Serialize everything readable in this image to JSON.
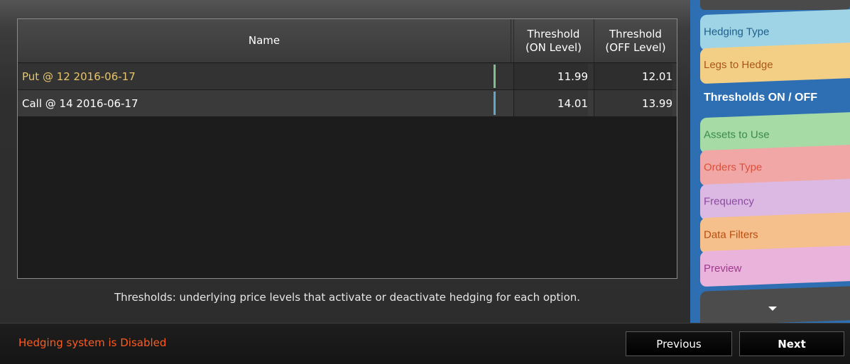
{
  "table": {
    "headers": {
      "name": "Name",
      "on_line1": "Threshold",
      "on_line2": "(ON Level)",
      "off_line1": "Threshold",
      "off_line2": "(OFF Level)"
    },
    "rows": [
      {
        "name": "Put @ 12 2016-06-17",
        "on": "11.99",
        "off": "12.01",
        "name_color": "#e8c56a",
        "marker_color": "#7fc08a"
      },
      {
        "name": "Call @ 14 2016-06-17",
        "on": "14.01",
        "off": "13.99",
        "name_color": "#ffffff",
        "marker_color": "#5fa8cc"
      }
    ]
  },
  "hint": "Thresholds: underlying price levels that activate or deactivate hedging for each option.",
  "status": "Hedging system is Disabled",
  "buttons": {
    "previous": "Previous",
    "next": "Next"
  },
  "side_nav": [
    {
      "label": "Hedging Type",
      "bg": "#9fd3e6",
      "color": "#1e5f8c"
    },
    {
      "label": "Legs to Hedge",
      "bg": "#f3cf86",
      "color": "#a9561a"
    },
    {
      "label": "Thresholds ON / OFF",
      "bg": "",
      "color": "#ffffff",
      "active": true
    },
    {
      "label": "Assets to Use",
      "bg": "#a6dba5",
      "color": "#3b8a4a"
    },
    {
      "label": "Orders Type",
      "bg": "#f2a7a7",
      "color": "#d9503a"
    },
    {
      "label": "Frequency",
      "bg": "#dcb9e3",
      "color": "#8a4aa0"
    },
    {
      "label": "Data Filters",
      "bg": "#f6c08c",
      "color": "#b84e12"
    },
    {
      "label": "Preview",
      "bg": "#eab3db",
      "color": "#a03a8f"
    }
  ],
  "icons": {
    "more": "chevron-down-icon"
  },
  "colors": {
    "status": "#ff5a1f",
    "nav_bg": "#2e6fb3"
  }
}
